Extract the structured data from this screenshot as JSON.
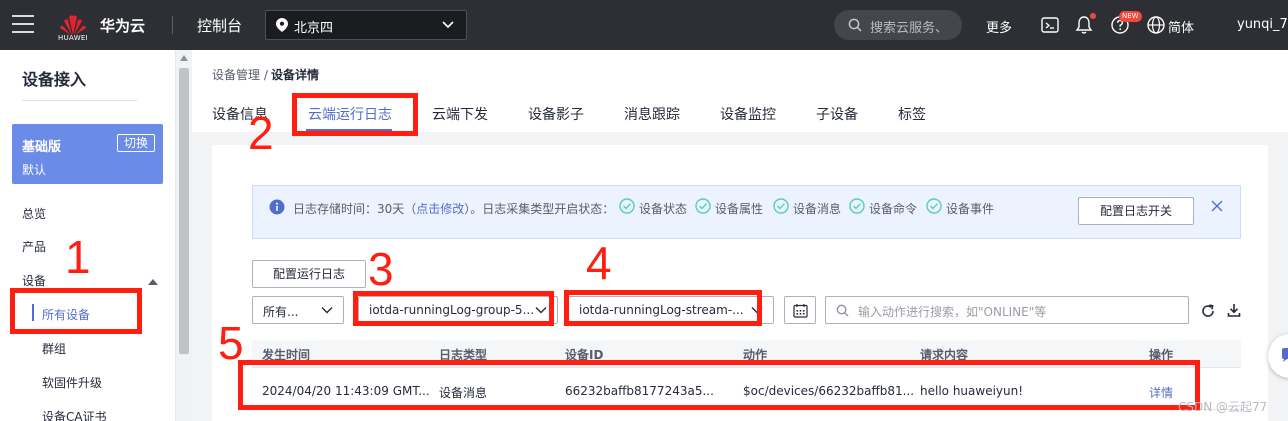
{
  "topbar": {
    "logo_text": "HUAWEI",
    "brand": "华为云",
    "console": "控制台",
    "region": "北京四",
    "search_placeholder": "搜索云服务、",
    "more": "更多",
    "new_badge": "NEW",
    "language": "简体",
    "user": "yunqi_7"
  },
  "sidebar": {
    "title": "设备接入",
    "edition": {
      "name": "基础版",
      "switch": "切换",
      "sub": "默认"
    },
    "items": [
      {
        "label": "总览"
      },
      {
        "label": "产品"
      },
      {
        "label": "设备"
      }
    ],
    "subitems": [
      {
        "label": "所有设备",
        "active": true
      },
      {
        "label": "群组"
      },
      {
        "label": "软固件升级"
      },
      {
        "label": "设备CA证书"
      }
    ]
  },
  "breadcrumb": {
    "parent": "设备管理 /",
    "current": "设备详情"
  },
  "tabs": [
    {
      "label": "设备信息"
    },
    {
      "label": "云端运行日志",
      "active": true
    },
    {
      "label": "云端下发"
    },
    {
      "label": "设备影子"
    },
    {
      "label": "消息跟踪"
    },
    {
      "label": "设备监控"
    },
    {
      "label": "子设备"
    },
    {
      "label": "标签"
    }
  ],
  "notice": {
    "text_prefix": "日志存储时间：30天（",
    "link": "点击修改",
    "text_suffix": "）。日志采集类型开启状态：",
    "checks": [
      "设备状态",
      "设备属性",
      "设备消息",
      "设备命令",
      "设备事件"
    ],
    "config_button": "配置日志开关"
  },
  "run_log_button": "配置运行日志",
  "filters": {
    "type_select": "所有...",
    "group_select": "iotda-runningLog-group-5...",
    "stream_select": "iotda-runningLog-stream-...",
    "search_placeholder": "输入动作进行搜索，如\"ONLINE\"等"
  },
  "table": {
    "headers": [
      "发生时间",
      "日志类型",
      "设备ID",
      "动作",
      "请求内容",
      "操作"
    ],
    "rows": [
      {
        "time": "2024/04/20 11:43:09 GMT...",
        "type": "设备消息",
        "device_id": "66232baffb8177243a5...",
        "action": "$oc/devices/66232baffb81...",
        "content": "hello huaweiyun!",
        "op": "详情"
      }
    ]
  },
  "annotations": [
    "1",
    "2",
    "3",
    "4",
    "5"
  ],
  "watermark": "CSDN @云起77",
  "colors": {
    "accent": "#526ecc",
    "annotation": "#ff1e10",
    "topbar": "#2d2f34",
    "edition": "#6a8be8"
  }
}
